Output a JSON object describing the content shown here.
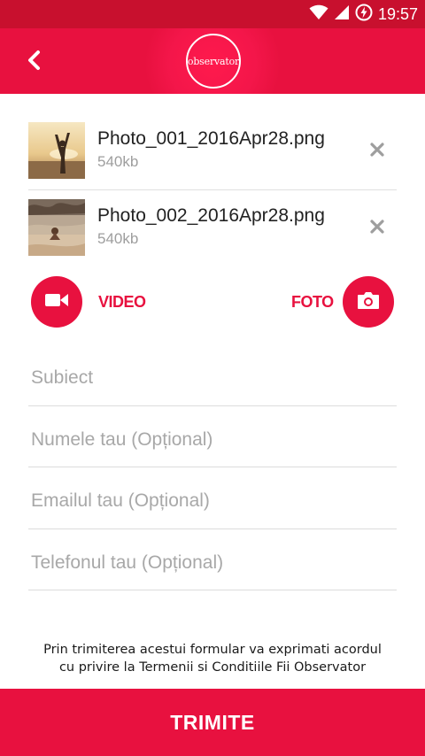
{
  "status_bar": {
    "time": "19:57",
    "icons": [
      "wifi-icon",
      "cell-signal-icon",
      "battery-charging-icon"
    ]
  },
  "app_bar": {
    "back_icon": "chevron-left-icon",
    "logo_text": "observator"
  },
  "attachments": [
    {
      "file_name": "Photo_001_2016Apr28.png",
      "size": "540kb",
      "remove_icon": "close-icon"
    },
    {
      "file_name": "Photo_002_2016Apr28.png",
      "size": "540kb",
      "remove_icon": "close-icon"
    }
  ],
  "media": {
    "video_label": "VIDEO",
    "video_icon": "video-camera-icon",
    "foto_label": "FOTO",
    "foto_icon": "camera-icon"
  },
  "form": {
    "subject_placeholder": "Subiect",
    "name_placeholder": "Numele tau (Opțional)",
    "email_placeholder": "Emailul tau (Opțional)",
    "phone_placeholder": "Telefonul tau (Opțional)"
  },
  "terms": {
    "line1": "Prin trimiterea acestui formular va exprimati acordul",
    "line2": "cu privire la Termenii si Conditiile Fii Observator"
  },
  "submit": {
    "label": "TRIMITE"
  },
  "colors": {
    "brand_red": "#e8113f",
    "status_bar": "#c8102e",
    "placeholder_gray": "#a8a8a8",
    "size_gray": "#9e9e9e"
  }
}
